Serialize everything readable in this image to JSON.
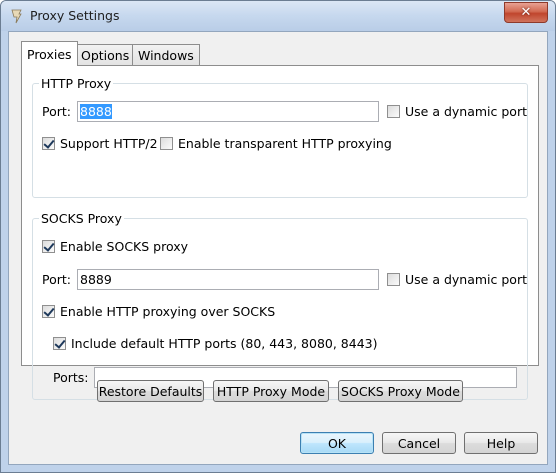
{
  "window": {
    "title": "Proxy Settings",
    "close_label": "✕"
  },
  "tabs": [
    {
      "label": "Proxies",
      "active": true
    },
    {
      "label": "Options",
      "active": false
    },
    {
      "label": "Windows",
      "active": false
    }
  ],
  "http_proxy": {
    "legend": "HTTP Proxy",
    "port_label": "Port:",
    "port_value": "8888",
    "dynamic_port_label": "Use a dynamic port",
    "dynamic_port_checked": false,
    "http2_label": "Support HTTP/2",
    "http2_checked": true,
    "transparent_label": "Enable transparent HTTP proxying",
    "transparent_checked": false
  },
  "socks_proxy": {
    "legend": "SOCKS Proxy",
    "enable_label": "Enable SOCKS proxy",
    "enable_checked": true,
    "port_label": "Port:",
    "port_value": "8889",
    "dynamic_port_label": "Use a dynamic port",
    "dynamic_port_checked": false,
    "http_over_socks_label": "Enable HTTP proxying over SOCKS",
    "http_over_socks_checked": true,
    "default_ports_label": "Include default HTTP ports (80, 443, 8080, 8443)",
    "default_ports_checked": true,
    "ports_label": "Ports:",
    "ports_value": ""
  },
  "mode_buttons": {
    "restore": "Restore Defaults",
    "http_mode": "HTTP Proxy Mode",
    "socks_mode": "SOCKS Proxy Mode"
  },
  "dialog_buttons": {
    "ok": "OK",
    "cancel": "Cancel",
    "help": "Help"
  }
}
